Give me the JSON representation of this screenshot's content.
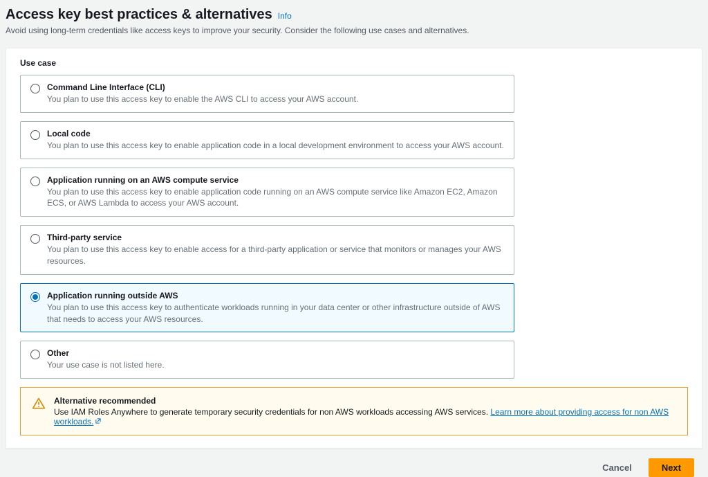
{
  "header": {
    "title": "Access key best practices & alternatives",
    "info": "Info",
    "subtitle": "Avoid using long-term credentials like access keys to improve your security. Consider the following use cases and alternatives."
  },
  "section": {
    "label": "Use case"
  },
  "options": [
    {
      "title": "Command Line Interface (CLI)",
      "desc": "You plan to use this access key to enable the AWS CLI to access your AWS account."
    },
    {
      "title": "Local code",
      "desc": "You plan to use this access key to enable application code in a local development environment to access your AWS account."
    },
    {
      "title": "Application running on an AWS compute service",
      "desc": "You plan to use this access key to enable application code running on an AWS compute service like Amazon EC2, Amazon ECS, or AWS Lambda to access your AWS account."
    },
    {
      "title": "Third-party service",
      "desc": "You plan to use this access key to enable access for a third-party application or service that monitors or manages your AWS resources."
    },
    {
      "title": "Application running outside AWS",
      "desc": "You plan to use this access key to authenticate workloads running in your data center or other infrastructure outside of AWS that needs to access your AWS resources."
    },
    {
      "title": "Other",
      "desc": "Your use case is not listed here."
    }
  ],
  "selected_index": 4,
  "alert": {
    "title": "Alternative recommended",
    "text_prefix": "Use IAM Roles Anywhere to generate temporary security credentials for non AWS workloads accessing AWS services. ",
    "link_text": "Learn more about providing access for non AWS workloads."
  },
  "footer": {
    "cancel": "Cancel",
    "next": "Next"
  }
}
